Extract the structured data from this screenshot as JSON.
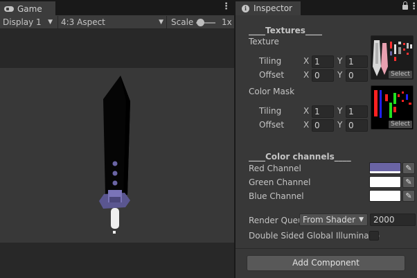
{
  "game": {
    "tab_label": "Game",
    "display": "Display 1",
    "aspect": "4:3 Aspect",
    "scale_label": "Scale",
    "scale_value": "1x",
    "scale_slider": 0.05
  },
  "inspector": {
    "tab_label": "Inspector",
    "textures_header": "____Textures____",
    "texture_label": "Texture",
    "texture_tiling_label": "Tiling",
    "texture_offset_label": "Offset",
    "texture_tiling_x": "1",
    "texture_tiling_y": "1",
    "texture_offset_x": "0",
    "texture_offset_y": "0",
    "color_mask_label": "Color Mask",
    "mask_tiling_label": "Tiling",
    "mask_offset_label": "Offset",
    "mask_tiling_x": "1",
    "mask_tiling_y": "1",
    "mask_offset_x": "0",
    "mask_offset_y": "0",
    "x_label": "X",
    "y_label": "Y",
    "select_label": "Select",
    "channels_header": "____Color channels____",
    "red_label": "Red Channel",
    "green_label": "Green Channel",
    "blue_label": "Blue Channel",
    "red_color": "#6a64a4",
    "green_color": "#ffffff",
    "blue_color": "#ffffff",
    "render_queue_label": "Render Queu",
    "render_queue_mode": "From Shader",
    "render_queue_value": "2000",
    "double_sided_label": "Double Sided Global Illuminatio",
    "double_sided_checked": false,
    "add_component_label": "Add Component"
  },
  "colors": {
    "accent": "#6a64a4",
    "blade": "#050505",
    "handle": "#eeeeee"
  }
}
